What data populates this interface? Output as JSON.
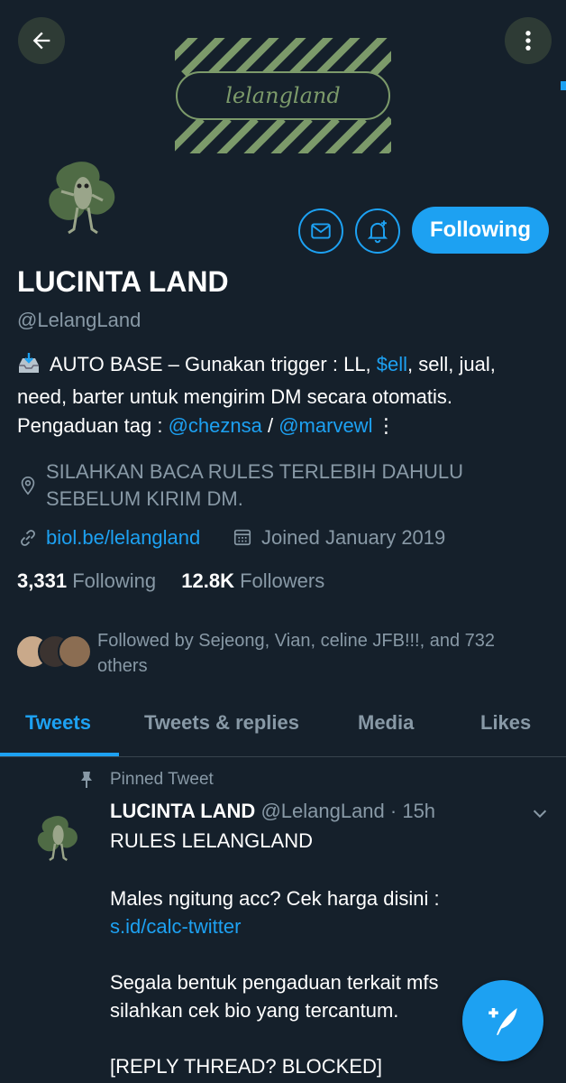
{
  "header": {
    "banner_text": "lelangland",
    "back_icon": "arrow-left-icon",
    "more_icon": "more-vertical-icon"
  },
  "profile": {
    "name": "LUCINTA LAND",
    "handle": "@LelangLand",
    "follow_button": "Following",
    "bio": {
      "prefix": "AUTO BASE – Gunakan trigger : LL, ",
      "cashtag": "$ell",
      "middle": ", sell, jual, need, barter untuk mengirim DM secara otomatis. Pengaduan tag : ",
      "mention1": "@cheznsa",
      "separator": " / ",
      "mention2": "@marvewl"
    },
    "location": "SILAHKAN BACA RULES TERLEBIH DAHULU SEBELUM KIRIM DM.",
    "website": "biol.be/lelangland",
    "joined": "Joined January 2019",
    "following_count": "3,331",
    "following_label": "Following",
    "followers_count": "12.8K",
    "followers_label": "Followers",
    "followed_by": "Followed by Sejeong, Vian, celine JFB!!!, and 732 others"
  },
  "tabs": [
    {
      "label": "Tweets",
      "active": true
    },
    {
      "label": "Tweets & replies",
      "active": false
    },
    {
      "label": "Media",
      "active": false
    },
    {
      "label": "Likes",
      "active": false
    }
  ],
  "tweet": {
    "pinned_label": "Pinned Tweet",
    "author": "LUCINTA LAND",
    "handle_time": "@LelangLand · 15h",
    "line1": "RULES LELANGLAND",
    "line2": "Males ngitung acc? Cek harga disini :",
    "link": "s.id/calc-twitter",
    "line3a": "Segala bentuk pengaduan terkait mfs",
    "line3b": "silahkan cek bio yang tercantum.",
    "line4": "[REPLY THREAD? BLOCKED]"
  },
  "colors": {
    "background": "#15202b",
    "accent": "#1da1f2",
    "secondary_text": "#8899a6",
    "banner_green": "#7c9a6a"
  }
}
